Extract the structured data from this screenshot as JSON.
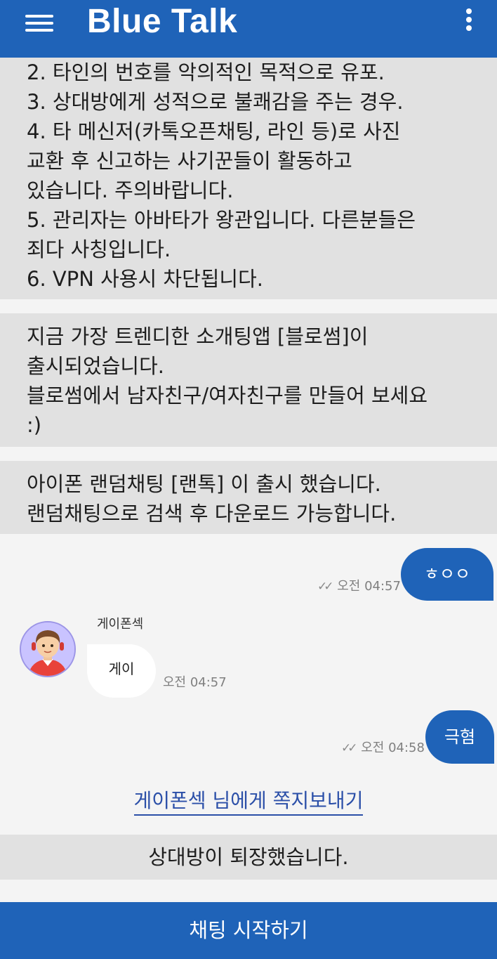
{
  "app": {
    "title": "Blue Talk",
    "menu_icon": "hamburger-menu-icon",
    "more_icon": "vertical-dots-icon",
    "brand_color": "#1f63b8"
  },
  "notices": [
    {
      "lines": [
        "2. 타인의 번호를 악의적인 목적으로 유포.",
        "3. 상대방에게 성적으로 불쾌감을 주는 경우.",
        "4. 타 메신저(카톡오픈채팅, 라인 등)로 사진",
        "교환 후 신고하는 사기꾼들이 활동하고",
        "있습니다. 주의바랍니다.",
        "5. 관리자는 아바타가 왕관입니다. 다른분들은",
        "죄다 사칭입니다.",
        "6. VPN 사용시 차단됩니다."
      ]
    },
    {
      "lines": [
        "지금 가장 트렌디한 소개팅앱 [블로썸]이",
        "출시되었습니다.",
        "블로썸에서 남자친구/여자친구를 만들어 보세요",
        ":)"
      ]
    },
    {
      "lines": [
        "아이폰 랜덤채팅 [랜톡] 이 출시 했습니다.",
        "랜덤채팅으로 검색 후 다운로드 가능합니다."
      ]
    }
  ],
  "messages": [
    {
      "direction": "out",
      "text": "ㅎㅇㅇ",
      "time": "오전 04:57",
      "read_icon": "double-check-icon"
    },
    {
      "direction": "in",
      "sender": "게이폰섹",
      "avatar_icon": "user-avatar-icon",
      "text": "게이",
      "time": "오전 04:57"
    },
    {
      "direction": "out",
      "text": "극혐",
      "time": "오전 04:58",
      "read_icon": "double-check-icon"
    }
  ],
  "dm_link": "게이폰섹 님에게 쪽지보내기",
  "status_banner": "상대방이 퇴장했습니다.",
  "start_button": "채팅 시작하기"
}
